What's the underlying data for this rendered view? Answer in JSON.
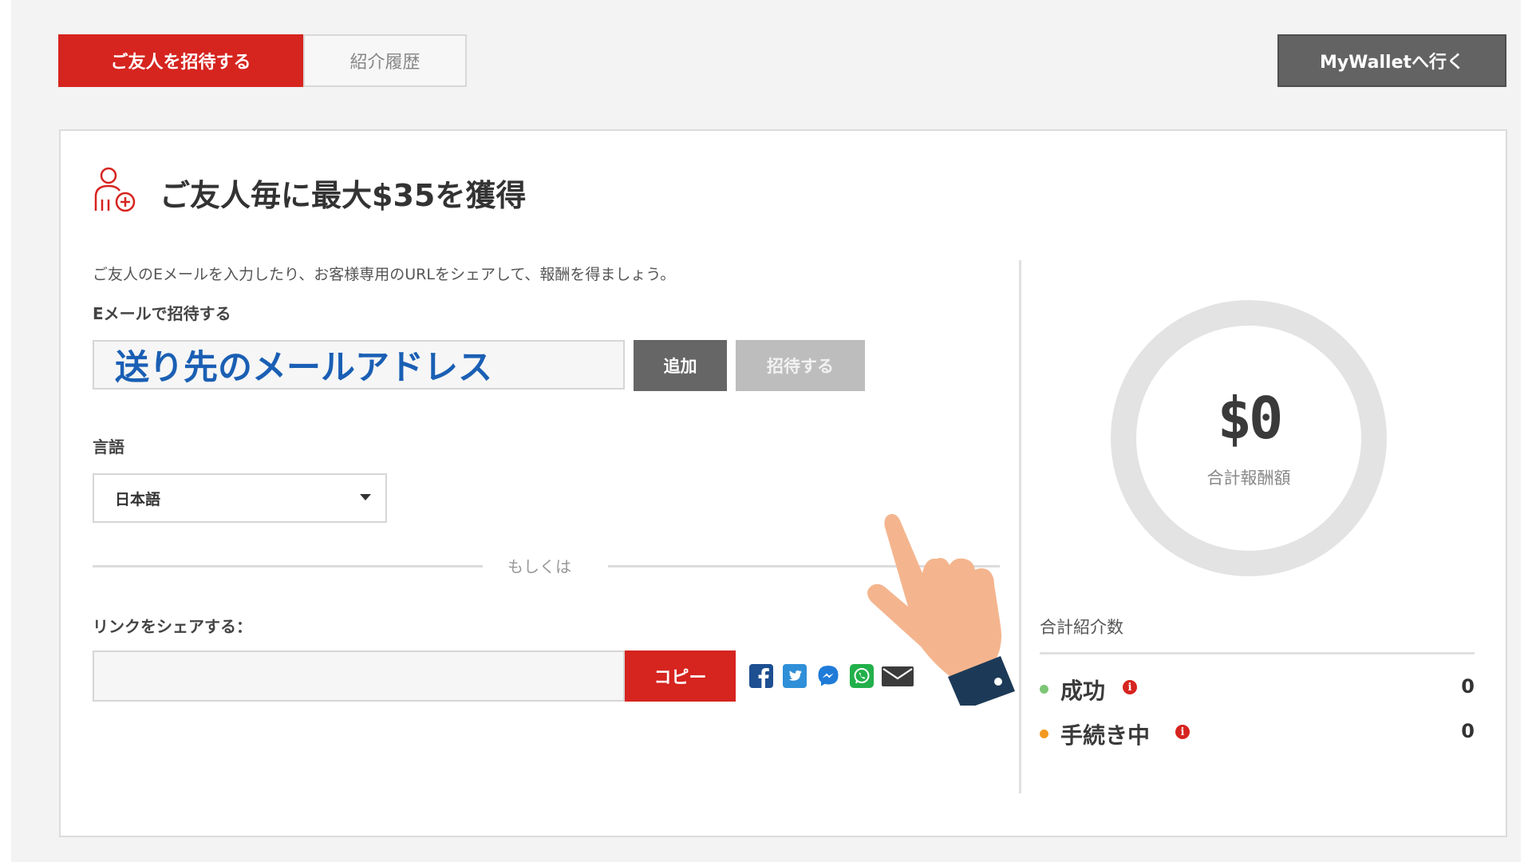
{
  "tabs": {
    "invite_label": "ご友人を招待する",
    "history_label": "紹介履歴"
  },
  "wallet_button": "MyWalletへ行く",
  "card": {
    "title": "ご友人毎に最大$35を獲得",
    "intro": "ご友人のEメールを入力したり、お客様専用のURLをシェアして、報酬を得ましょう。",
    "email_section_label": "Eメールで招待する",
    "email_input_value": "送り先のメールアドレス",
    "add_button": "追加",
    "invite_button": "招待する",
    "language_label": "言語",
    "language_selected": "日本語",
    "or_text": "もしくは",
    "share_label": "リンクをシェアする：",
    "copy_button": "コピー",
    "social_icons": [
      "facebook-icon",
      "twitter-icon",
      "messenger-icon",
      "whatsapp-icon",
      "email-icon"
    ]
  },
  "summary": {
    "total_amount": "$0",
    "total_amount_label": "合計報酬額",
    "referrals_title": "合計紹介数",
    "statuses": [
      {
        "label": "成功",
        "value": "0",
        "dot_color": "#7cc576"
      },
      {
        "label": "手続き中",
        "value": "0",
        "dot_color": "#f39a1f"
      }
    ]
  },
  "colors": {
    "brand_red": "#d6241f",
    "email_text_blue": "#1a5fb4",
    "donut_ring": "#e3e3e3",
    "cuff_navy": "#1c3a57",
    "skin": "#f4b58e"
  }
}
